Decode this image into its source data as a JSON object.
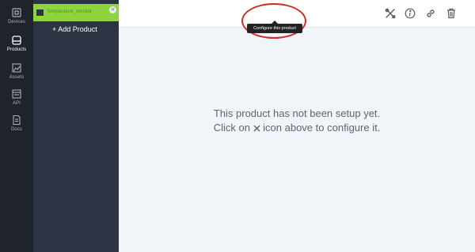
{
  "rail": {
    "items": [
      {
        "label": "Devices",
        "icon": "device-icon",
        "active": false
      },
      {
        "label": "Products",
        "icon": "product-box-icon",
        "active": true
      },
      {
        "label": "Assets",
        "icon": "image-icon",
        "active": false
      },
      {
        "label": "API",
        "icon": "api-window-icon",
        "active": false
      },
      {
        "label": "Docs",
        "icon": "document-icon",
        "active": false
      }
    ]
  },
  "products": {
    "selected_name": "Temperature_monitor",
    "close_glyph": "×",
    "add_label": "+ Add Product"
  },
  "toolbar": {
    "icons": [
      "configure-tools-icon",
      "info-icon",
      "link-icon",
      "trash-icon"
    ],
    "tooltip": "Configure this product"
  },
  "main": {
    "line1": "This product has not been setup yet.",
    "line2_before": "Click on ",
    "line2_after": " icon above to configure it."
  },
  "colors": {
    "rail_bg": "#1e232c",
    "sidebar_bg": "#2d3544",
    "selected_product": "#8fd43d",
    "main_bg": "#f1f4f8",
    "highlight": "#cc2d24"
  }
}
